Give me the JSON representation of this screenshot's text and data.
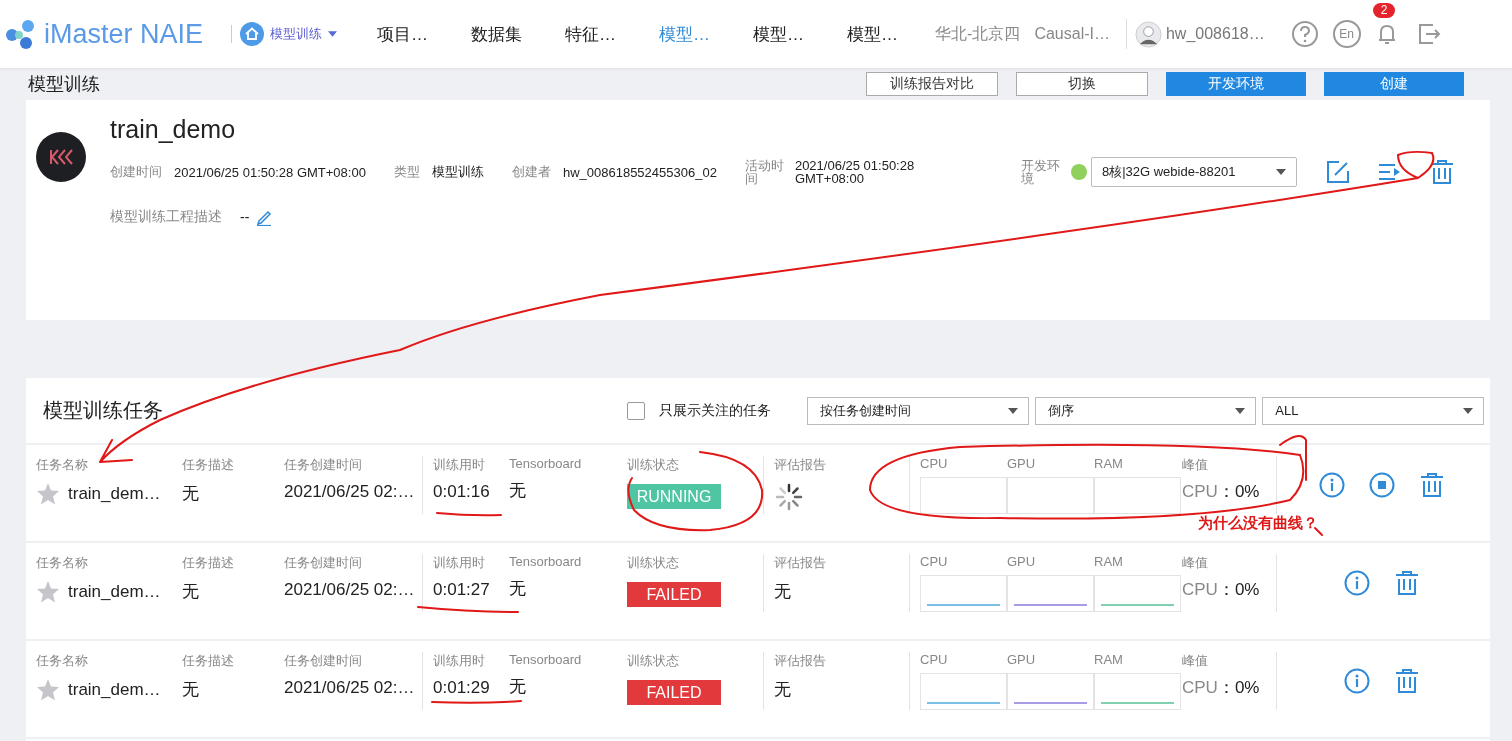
{
  "header": {
    "logo": "iMaster NAIE",
    "workspace": "模型训练",
    "nav": [
      {
        "label": "项目…",
        "selected": false
      },
      {
        "label": "数据集",
        "selected": false
      },
      {
        "label": "特征…",
        "selected": false
      },
      {
        "label": "模型…",
        "selected": true
      },
      {
        "label": "模型…",
        "selected": false
      },
      {
        "label": "模型…",
        "selected": false
      }
    ],
    "region": "华北-北京四",
    "project": "Causal-I…",
    "user": "hw_008618…",
    "language": "En",
    "notifications": "2"
  },
  "page": {
    "title": "模型训练",
    "buttons": [
      {
        "label": "训练报告对比",
        "kind": "secondary"
      },
      {
        "label": "切换",
        "kind": "secondary"
      },
      {
        "label": "开发环境",
        "kind": "primary"
      },
      {
        "label": "创建",
        "kind": "primary"
      }
    ]
  },
  "project": {
    "name": "train_demo",
    "fields": [
      {
        "label": "创建时间",
        "value": "2021/06/25 01:50:28 GMT+08:00"
      },
      {
        "label": "类型",
        "value": "模型训练"
      },
      {
        "label": "创建者",
        "value": "hw_008618552455306_02"
      },
      {
        "label": "活动时间",
        "value": "2021/06/25 01:50:28 GMT+08:00"
      }
    ],
    "env_label": "开发环境",
    "env_value": "8核|32G webide-88201",
    "description_label": "模型训练工程描述",
    "description": "--"
  },
  "tasks": {
    "title": "模型训练任务",
    "followed_only": {
      "label": "只展示关注的任务",
      "checked": false
    },
    "sort_by": "按任务创建时间",
    "order": "倒序",
    "filter": "ALL",
    "rows": [
      {
        "labels": [
          "任务名称",
          "任务描述",
          "任务创建时间",
          "训练用时",
          "Tensorboard",
          "训练状态",
          "评估报告",
          "CPU",
          "GPU",
          "RAM",
          "峰值"
        ],
        "name": "train_dem…",
        "starred": false,
        "description": "无",
        "created": "2021/06/25 02:…",
        "duration": "0:01:16",
        "tensorboard": "无",
        "status": {
          "label": "RUNNING",
          "kind": "running"
        },
        "report": {
          "kind": "loading"
        },
        "usage_lines": false,
        "peak_metric": "CPU",
        "peak_value": "：0%",
        "actions": [
          {
            "kind": "info"
          },
          {
            "kind": "stop"
          },
          {
            "kind": "delete"
          }
        ]
      },
      {
        "labels": [
          "任务名称",
          "任务描述",
          "任务创建时间",
          "训练用时",
          "Tensorboard",
          "训练状态",
          "评估报告",
          "CPU",
          "GPU",
          "RAM",
          "峰值"
        ],
        "name": "train_dem…",
        "starred": false,
        "description": "无",
        "created": "2021/06/25 02:…",
        "duration": "0:01:27",
        "tensorboard": "无",
        "status": {
          "label": "FAILED",
          "kind": "failed"
        },
        "report": {
          "kind": "text",
          "label": "无"
        },
        "usage_lines": true,
        "peak_metric": "CPU",
        "peak_value": "：0%",
        "actions": [
          {
            "kind": "info"
          },
          {
            "kind": "delete"
          }
        ]
      },
      {
        "labels": [
          "任务名称",
          "任务描述",
          "任务创建时间",
          "训练用时",
          "Tensorboard",
          "训练状态",
          "评估报告",
          "CPU",
          "GPU",
          "RAM",
          "峰值"
        ],
        "name": "train_dem…",
        "starred": false,
        "description": "无",
        "created": "2021/06/25 02:…",
        "duration": "0:01:29",
        "tensorboard": "无",
        "status": {
          "label": "FAILED",
          "kind": "failed"
        },
        "report": {
          "kind": "text",
          "label": "无"
        },
        "usage_lines": true,
        "peak_metric": "CPU",
        "peak_value": "：0%",
        "actions": [
          {
            "kind": "info"
          },
          {
            "kind": "delete"
          }
        ]
      }
    ]
  },
  "annotation": {
    "note": "为什么没有曲线？"
  }
}
